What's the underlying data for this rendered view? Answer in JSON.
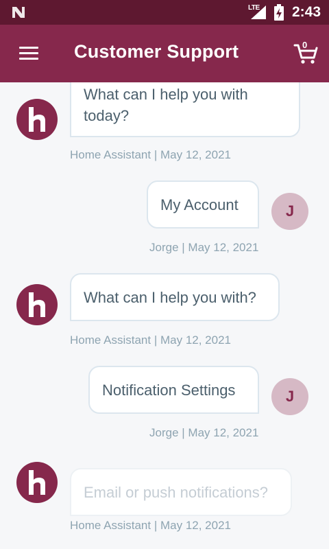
{
  "status_bar": {
    "network": "LTE",
    "time": "2:43"
  },
  "app_bar": {
    "title": "Customer Support",
    "cart_count": "0"
  },
  "messages": [
    {
      "from": "bot",
      "text": "What can I help you with today?",
      "author": "Home Assistant",
      "date": "May 12, 2021"
    },
    {
      "from": "user",
      "avatar_initial": "J",
      "text": "My Account",
      "author": "Jorge",
      "date": "May 12, 2021"
    },
    {
      "from": "bot",
      "text": "What can I help you with?",
      "author": "Home Assistant",
      "date": "May 12, 2021"
    },
    {
      "from": "user",
      "avatar_initial": "J",
      "text": "Notification Settings",
      "author": "Jorge",
      "date": "May 12, 2021"
    },
    {
      "from": "bot",
      "text": "Email or push notifications?",
      "author": "Home Assistant",
      "date": "May 12, 2021"
    }
  ],
  "separator": " | ",
  "colors": {
    "status_bar": "#5e1830",
    "app_bar": "#86284c",
    "user_avatar": "#d6b9c5",
    "background": "#f6f7f9"
  }
}
